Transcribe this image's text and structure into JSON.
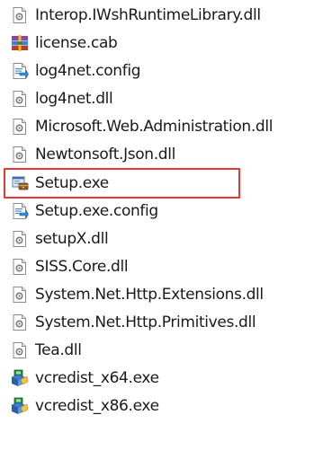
{
  "files": [
    {
      "name": "Interop.IWshRuntimeLibrary.dll",
      "icon": "dll-file-icon"
    },
    {
      "name": "license.cab",
      "icon": "winrar-archive-icon"
    },
    {
      "name": "log4net.config",
      "icon": "config-file-icon"
    },
    {
      "name": "log4net.dll",
      "icon": "dll-file-icon"
    },
    {
      "name": "Microsoft.Web.Administration.dll",
      "icon": "dll-file-icon"
    },
    {
      "name": "Newtonsoft.Json.dll",
      "icon": "dll-file-icon"
    },
    {
      "name": "Setup.exe",
      "icon": "setup-exe-icon",
      "highlighted": true
    },
    {
      "name": "Setup.exe.config",
      "icon": "config-file-icon"
    },
    {
      "name": "setupX.dll",
      "icon": "dll-file-icon"
    },
    {
      "name": "SISS.Core.dll",
      "icon": "dll-file-icon"
    },
    {
      "name": "System.Net.Http.Extensions.dll",
      "icon": "dll-file-icon"
    },
    {
      "name": "System.Net.Http.Primitives.dll",
      "icon": "dll-file-icon"
    },
    {
      "name": "Tea.dll",
      "icon": "dll-file-icon"
    },
    {
      "name": "vcredist_x64.exe",
      "icon": "installer-exe-icon"
    },
    {
      "name": "vcredist_x86.exe",
      "icon": "installer-exe-icon"
    }
  ],
  "colors": {
    "highlight_border": "#e53935"
  }
}
